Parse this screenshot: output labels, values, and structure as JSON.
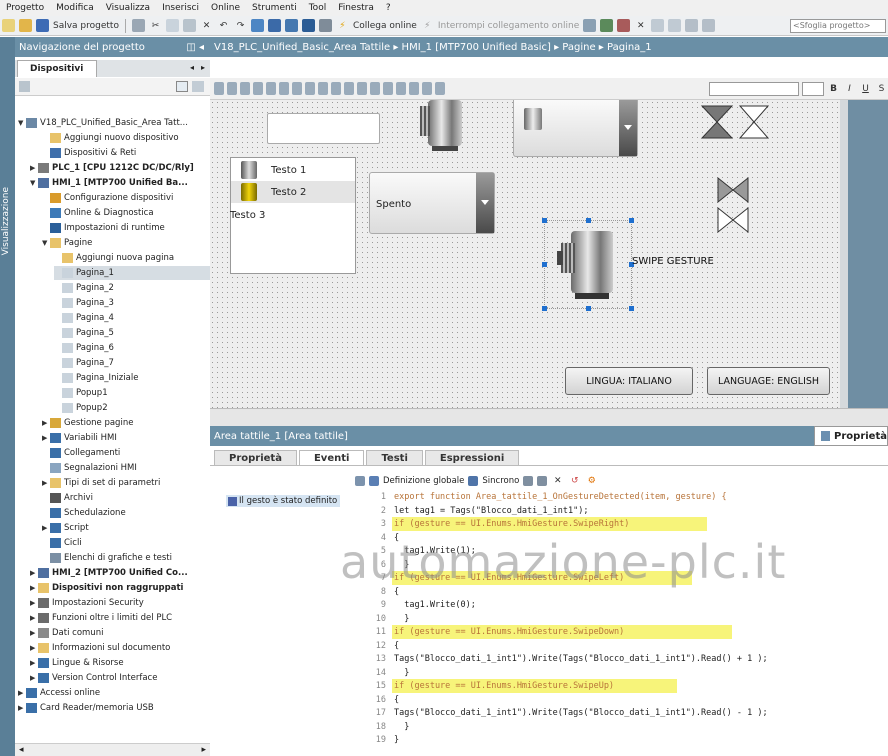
{
  "menu": [
    "Progetto",
    "Modifica",
    "Visualizza",
    "Inserisci",
    "Online",
    "Strumenti",
    "Tool",
    "Finestra",
    "?"
  ],
  "toolbar": {
    "save_label": "Salva progetto",
    "connect_online": "Collega online",
    "disconnect_online": "Interrompi collegamento online",
    "search_placeholder": "<Sfoglia progetto>"
  },
  "vertical_tab": "Visualizzazione",
  "nav": {
    "title": "Navigazione del progetto",
    "tab": "Dispositivi"
  },
  "breadcrumb": "V18_PLC_Unified_Basic_Area Tattile  ▸  HMI_1 [MTP700 Unified Basic]  ▸  Pagine  ▸  Pagina_1",
  "tree": [
    {
      "label": "V18_PLC_Unified_Basic_Area Tatt..."
    },
    {
      "label": "Aggiungi nuovo dispositivo"
    },
    {
      "label": "Dispositivi & Reti"
    },
    {
      "label": "PLC_1 [CPU 1212C DC/DC/Rly]"
    },
    {
      "label": "HMI_1 [MTP700 Unified Ba..."
    },
    {
      "label": "Configurazione dispositivi"
    },
    {
      "label": "Online & Diagnostica"
    },
    {
      "label": "Impostazioni di runtime"
    },
    {
      "label": "Pagine"
    },
    {
      "label": "Aggiungi nuova pagina"
    },
    {
      "label": "Pagina_1"
    },
    {
      "label": "Pagina_2"
    },
    {
      "label": "Pagina_3"
    },
    {
      "label": "Pagina_4"
    },
    {
      "label": "Pagina_5"
    },
    {
      "label": "Pagina_6"
    },
    {
      "label": "Pagina_7"
    },
    {
      "label": "Pagina_Iniziale"
    },
    {
      "label": "Popup1"
    },
    {
      "label": "Popup2"
    },
    {
      "label": "Gestione pagine"
    },
    {
      "label": "Variabili HMI"
    },
    {
      "label": "Collegamenti"
    },
    {
      "label": "Segnalazioni HMI"
    },
    {
      "label": "Tipi di set di parametri"
    },
    {
      "label": "Archivi"
    },
    {
      "label": "Schedulazione"
    },
    {
      "label": "Script"
    },
    {
      "label": "Cicli"
    },
    {
      "label": "Elenchi di grafiche e testi"
    },
    {
      "label": "HMI_2 [MTP700 Unified Co..."
    },
    {
      "label": "Dispositivi non raggruppati"
    },
    {
      "label": "Impostazioni Security"
    },
    {
      "label": "Funzioni oltre i limiti del PLC"
    },
    {
      "label": "Dati comuni"
    },
    {
      "label": "Informazioni sul documento"
    },
    {
      "label": "Lingue & Risorse"
    },
    {
      "label": "Version Control Interface"
    },
    {
      "label": "Accessi online"
    },
    {
      "label": "Card Reader/memoria USB"
    }
  ],
  "screen": {
    "list_items": [
      "Testo 1",
      "Testo 2",
      "Testo 3"
    ],
    "combo_value": "Spento",
    "swipe_label": "SWIPE GESTURE",
    "btn_it": "LINGUA: ITALIANO",
    "btn_en": "LANGUAGE: ENGLISH"
  },
  "props": {
    "title": "Area tattile_1 [Area tattile]",
    "properties_btn": "Proprietà",
    "tabs": [
      "Proprietà",
      "Eventi",
      "Testi",
      "Espressioni"
    ],
    "event": "Il gesto è stato definito",
    "global_def": "Definizione globale",
    "sync": "Sincrono"
  },
  "code": [
    {
      "n": "1",
      "t": "export function Area_tattile_1_OnGestureDetected(item, gesture) {"
    },
    {
      "n": "2",
      "t": "let tag1 = Tags(\"Blocco_dati_1_int1\");"
    },
    {
      "n": "3",
      "t": "if (gesture == UI.Enums.HmiGesture.SwipeRight)"
    },
    {
      "n": "4",
      "t": "{"
    },
    {
      "n": "5",
      "t": "  tag1.Write(1);"
    },
    {
      "n": "6",
      "t": "  }"
    },
    {
      "n": "7",
      "t": "if (gesture == UI.Enums.HmiGesture.SwipeLeft)"
    },
    {
      "n": "8",
      "t": "{"
    },
    {
      "n": "9",
      "t": "  tag1.Write(0);"
    },
    {
      "n": "10",
      "t": "  }"
    },
    {
      "n": "11",
      "t": "if (gesture == UI.Enums.HmiGesture.SwipeDown)"
    },
    {
      "n": "12",
      "t": "{"
    },
    {
      "n": "13",
      "t": "Tags(\"Blocco_dati_1_int1\").Write(Tags(\"Blocco_dati_1_int1\").Read() + 1 );"
    },
    {
      "n": "14",
      "t": "  }"
    },
    {
      "n": "15",
      "t": "if (gesture == UI.Enums.HmiGesture.SwipeUp)"
    },
    {
      "n": "16",
      "t": "{"
    },
    {
      "n": "17",
      "t": "Tags(\"Blocco_dati_1_int1\").Write(Tags(\"Blocco_dati_1_int1\").Read() - 1 );"
    },
    {
      "n": "18",
      "t": "  }"
    },
    {
      "n": "19",
      "t": "}"
    }
  ],
  "watermark": "automazione-plc.it",
  "colors": {
    "header": "#6a8fa6",
    "highlight": "#f7f47a",
    "selection": "#1e6fcf"
  }
}
